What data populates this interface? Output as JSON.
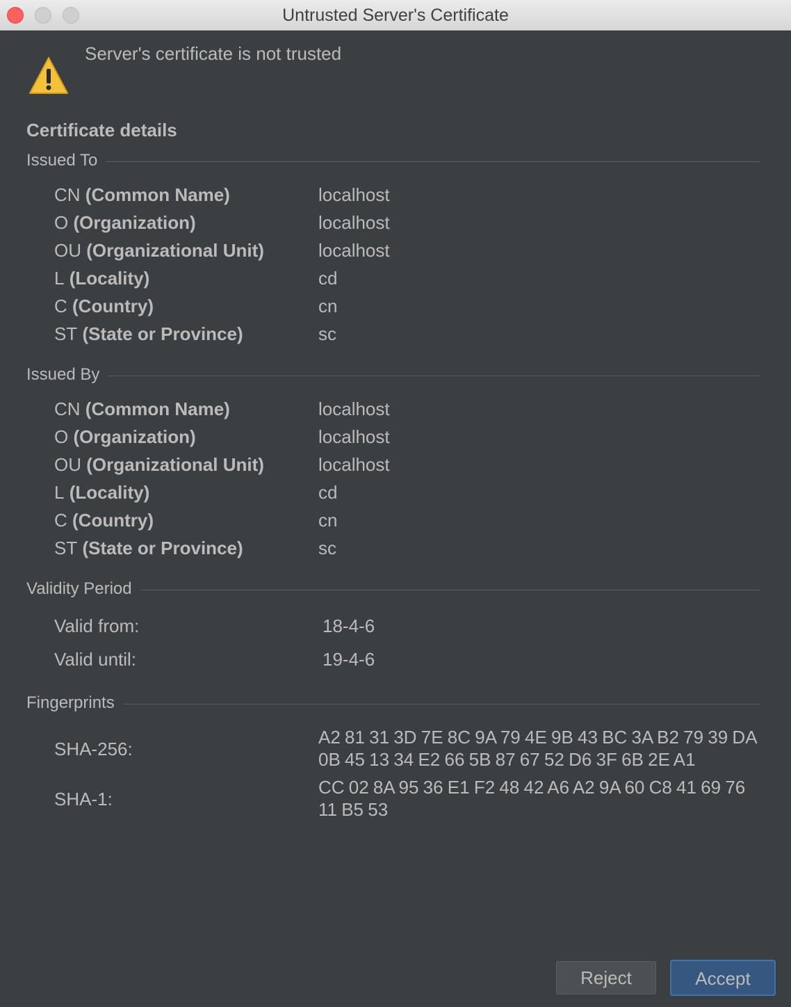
{
  "window": {
    "title": "Untrusted Server's Certificate"
  },
  "warning": {
    "icon": "warning-icon",
    "message": "Server's certificate is not trusted"
  },
  "details_title": "Certificate details",
  "issued_to": {
    "label": "Issued To",
    "fields": [
      {
        "abbr": "CN",
        "name": "Common Name",
        "value": "localhost"
      },
      {
        "abbr": "O",
        "name": "Organization",
        "value": "localhost"
      },
      {
        "abbr": "OU",
        "name": "Organizational Unit",
        "value": "localhost"
      },
      {
        "abbr": "L",
        "name": "Locality",
        "value": "cd"
      },
      {
        "abbr": "C",
        "name": "Country",
        "value": "cn"
      },
      {
        "abbr": "ST",
        "name": "State or Province",
        "value": "sc"
      }
    ]
  },
  "issued_by": {
    "label": "Issued By",
    "fields": [
      {
        "abbr": "CN",
        "name": "Common Name",
        "value": "localhost"
      },
      {
        "abbr": "O",
        "name": "Organization",
        "value": "localhost"
      },
      {
        "abbr": "OU",
        "name": "Organizational Unit",
        "value": "localhost"
      },
      {
        "abbr": "L",
        "name": "Locality",
        "value": "cd"
      },
      {
        "abbr": "C",
        "name": "Country",
        "value": "cn"
      },
      {
        "abbr": "ST",
        "name": "State or Province",
        "value": "sc"
      }
    ]
  },
  "validity": {
    "label": "Validity Period",
    "from_label": "Valid from:",
    "from_value": "18-4-6",
    "until_label": "Valid until:",
    "until_value": "19-4-6"
  },
  "fingerprints": {
    "label": "Fingerprints",
    "sha256_label": "SHA-256:",
    "sha256_value": "A2 81 31 3D 7E 8C 9A 79 4E 9B 43 BC 3A B2 79 39 DA 0B 45 13 34 E2 66 5B 87 67 52 D6 3F 6B 2E A1",
    "sha1_label": "SHA-1:",
    "sha1_value": "CC 02 8A 95 36 E1 F2 48 42 A6 A2 9A 60 C8 41 69 76 11 B5 53"
  },
  "buttons": {
    "reject": "Reject",
    "accept": "Accept"
  },
  "colors": {
    "background": "#3c3f41",
    "text": "#bbbbbb",
    "accent": "#365880",
    "warning": "#f3c13a"
  }
}
